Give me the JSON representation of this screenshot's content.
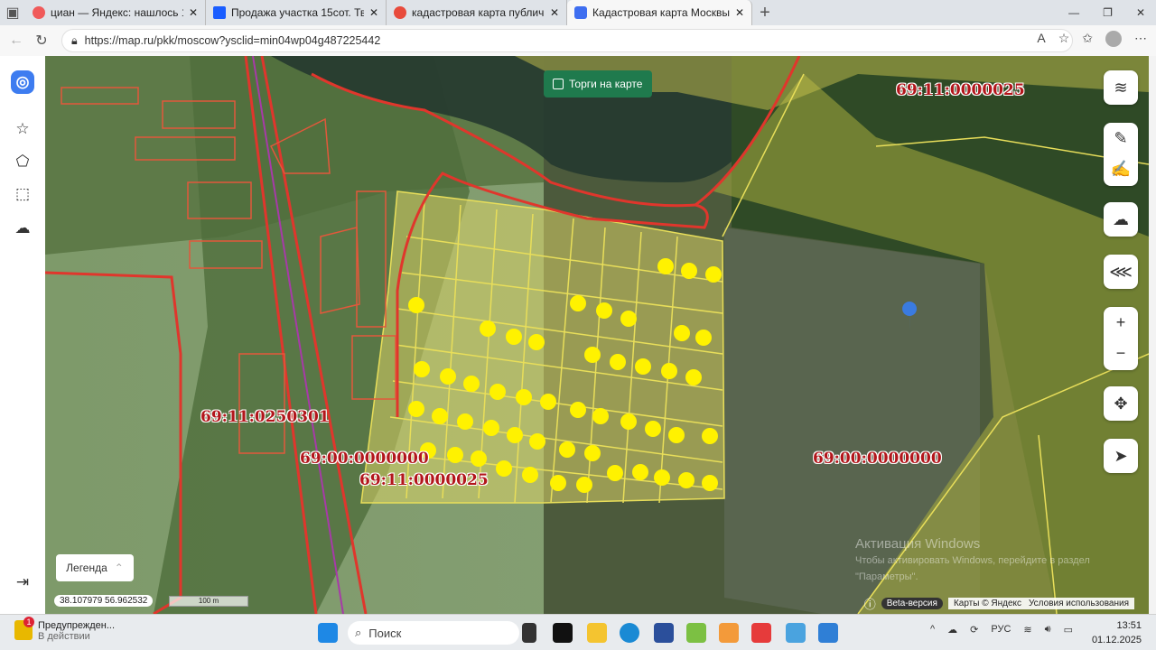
{
  "browser": {
    "tabs": [
      {
        "label": "циан — Яндекс: нашлось 11 млн",
        "color": "#f05a5a"
      },
      {
        "label": "Продажа участка 15сот. Тверская",
        "color": "#1a5dff"
      },
      {
        "label": "кадастровая карта публичная —",
        "color": "#e84b3c"
      },
      {
        "label": "Кадастровая карта Москвы | Map",
        "color": "#3e6ef0"
      }
    ],
    "url": "https://map.ru/pkk/moscow?ysclid=min04wp04g487225442"
  },
  "map": {
    "torgi_label": "Торги на карте",
    "legend_label": "Легенда",
    "coordinates": "38.107979   56.962532",
    "scale": "100 m",
    "beta": "Beta-версия",
    "copyright": "Карты © Яндекс",
    "terms": "Условия использования",
    "labels": [
      "69:11:0000025",
      "69:11:0250301",
      "69:00:0000000",
      "69:11:0000025",
      "69:00:0000000"
    ],
    "watermark": [
      "Активация Windows",
      "Чтобы активировать Windows, перейдите в раздел \"Параметры\"."
    ]
  },
  "taskbar": {
    "notification_title": "Предупрежден...",
    "notification_sub": "В действии",
    "notification_count": "1",
    "search_placeholder": "Поиск",
    "lang": "РУС",
    "time": "13:51",
    "date": "01.12.2025"
  }
}
